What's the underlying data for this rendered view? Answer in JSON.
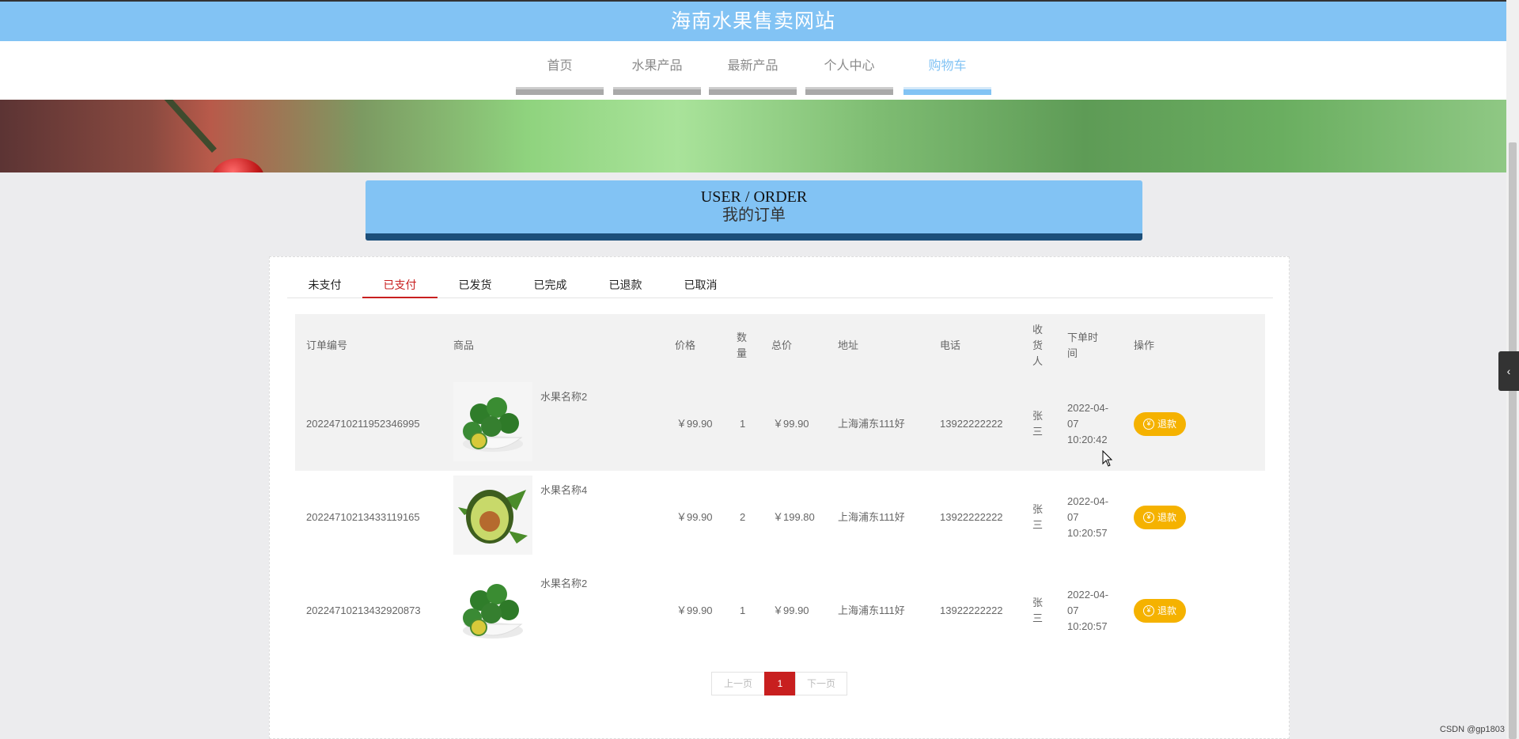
{
  "site": {
    "title": "海南水果售卖网站"
  },
  "nav": {
    "items": [
      "首页",
      "水果产品",
      "最新产品",
      "个人中心",
      "购物车"
    ],
    "active_index": 4
  },
  "page_head": {
    "en": "USER / ORDER",
    "cn": "我的订单"
  },
  "tabs": {
    "items": [
      "未支付",
      "已支付",
      "已发货",
      "已完成",
      "已退款",
      "已取消"
    ],
    "active_index": 1
  },
  "table": {
    "headers": {
      "order_no": "订单编号",
      "product": "商品",
      "price": "价格",
      "qty": "数量",
      "total": "总价",
      "address": "地址",
      "phone": "电话",
      "receiver": "收货人",
      "time": "下单时间",
      "action": "操作"
    },
    "rows": [
      {
        "order_no": "20224710211952346995",
        "product_name": "水果名称2",
        "price": "￥99.90",
        "qty": "1",
        "total": "￥99.90",
        "address": "上海浦东111好",
        "phone": "13922222222",
        "receiver": "张三",
        "time": "2022-04-07 10:20:42",
        "action": "退款",
        "image": "kumquat-bowl"
      },
      {
        "order_no": "20224710213433119165",
        "product_name": "水果名称4",
        "price": "￥99.90",
        "qty": "2",
        "total": "￥199.80",
        "address": "上海浦东111好",
        "phone": "13922222222",
        "receiver": "张三",
        "time": "2022-04-07 10:20:57",
        "action": "退款",
        "image": "avocado"
      },
      {
        "order_no": "20224710213432920873",
        "product_name": "水果名称2",
        "price": "￥99.90",
        "qty": "1",
        "total": "￥99.90",
        "address": "上海浦东111好",
        "phone": "13922222222",
        "receiver": "张三",
        "time": "2022-04-07 10:20:57",
        "action": "退款",
        "image": "kumquat-bowl"
      }
    ]
  },
  "pager": {
    "prev": "上一页",
    "current": "1",
    "next": "下一页"
  },
  "watermark": "CSDN @gp1803",
  "colors": {
    "header": "#82c3f4",
    "active_tab": "#c81f1f",
    "refund_button": "#f5b200",
    "head_bar": "#1c4f7a"
  },
  "icons": {
    "refund": "yen-circle-icon",
    "side_toggle": "chevron-left-icon"
  }
}
